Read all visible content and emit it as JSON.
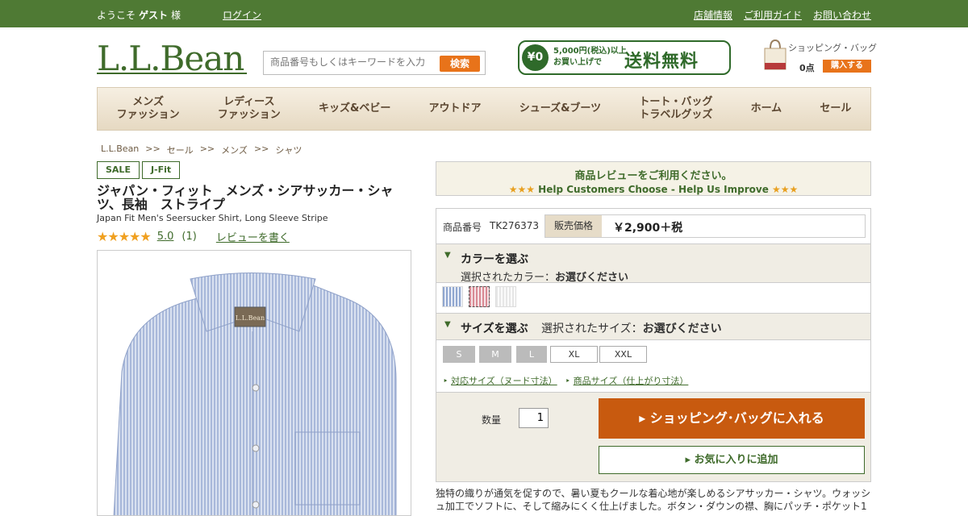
{
  "topbar": {
    "welcome_prefix": "ようこそ",
    "guest": "ゲスト",
    "welcome_suffix": "様",
    "login": "ログイン",
    "links": [
      "店舗情報",
      "ご利用ガイド",
      "お問い合わせ"
    ]
  },
  "header": {
    "logo": "L.L.Bean",
    "search_placeholder": "商品番号もしくはキーワードを入力",
    "search_button": "検索",
    "shipping_zero": "¥0",
    "shipping_line1": "5,000円(税込)以上",
    "shipping_line2": "お買い上げで",
    "shipping_big": "送料無料",
    "bag_label": "ショッピング・バッグ",
    "bag_count": "0点",
    "buy_button": "購入する"
  },
  "nav": [
    "メンズ\nファッション",
    "レディース\nファッション",
    "キッズ&ベビー",
    "アウトドア",
    "シューズ&ブーツ",
    "トート・バッグ\nトラベルグッズ",
    "ホーム",
    "セール"
  ],
  "breadcrumb": [
    "L.L.Bean",
    ">>",
    "セール",
    ">>",
    "メンズ",
    ">>",
    "シャツ"
  ],
  "product": {
    "tags": [
      "SALE",
      "J-Fit"
    ],
    "title": "ジャパン・フィット　メンズ・シアサッカー・シャツ、長袖　ストライプ",
    "subtitle": "Japan Fit Men's Seersucker Shirt, Long Sleeve Stripe",
    "stars": "★★★★★",
    "rating": "5.0",
    "review_count": "(1)",
    "write_review": "レビューを書く",
    "logo_tag": "L.L.Bean"
  },
  "review_banner": {
    "line1": "商品レビューをご利用ください。",
    "stars": "★★★",
    "line2": "Help Customers Choose - Help Us Improve"
  },
  "purchase": {
    "code_label": "商品番号",
    "code_value": "TK276373",
    "price_label": "販売価格",
    "price_value": "￥2,900＋税",
    "color_title": "カラーを選ぶ",
    "color_selected_label": "選択されたカラー：",
    "color_selected_value": "お選びください",
    "size_title": "サイズを選ぶ",
    "size_selected_label": "選択されたサイズ：",
    "size_selected_value": "お選びください",
    "sizes": [
      "S",
      "M",
      "L",
      "XL",
      "XXL"
    ],
    "size_link1": "対応サイズ（ヌード寸法）",
    "size_link2": "商品サイズ（仕上がり寸法）",
    "qty_label": "数量",
    "qty_value": "1",
    "add_to_cart": "ショッピング･バッグに入れる",
    "add_to_favorites": "お気に入りに追加"
  },
  "description": "独特の織りが通気を促すので、暑い夏もクールな着心地が楽しめるシアサッカー・シャツ。ウォッシュ加工でソフトに、そして縮みにくく仕上げました。ボタン・ダウンの襟、胸にパッチ・ポケット1"
}
